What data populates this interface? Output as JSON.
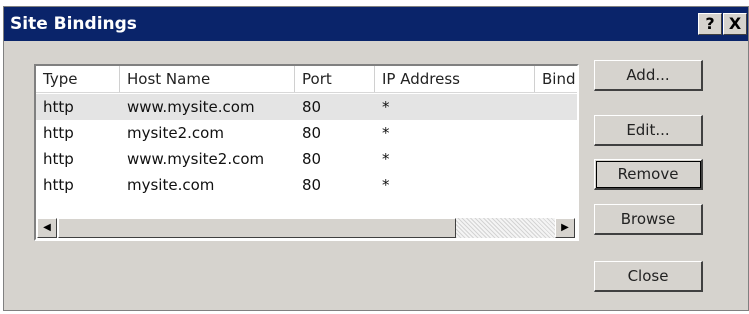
{
  "window": {
    "title": "Site Bindings",
    "help_label": "?",
    "close_label": "X"
  },
  "table": {
    "columns": [
      "Type",
      "Host Name",
      "Port",
      "IP Address",
      "Bind"
    ],
    "rows": [
      {
        "type": "http",
        "host": "www.mysite.com",
        "port": "80",
        "ip": "*",
        "selected": true
      },
      {
        "type": "http",
        "host": "mysite2.com",
        "port": "80",
        "ip": "*",
        "selected": false
      },
      {
        "type": "http",
        "host": "www.mysite2.com",
        "port": "80",
        "ip": "*",
        "selected": false
      },
      {
        "type": "http",
        "host": "mysite.com",
        "port": "80",
        "ip": "*",
        "selected": false
      }
    ]
  },
  "scrollbar": {
    "left_arrow": "◀",
    "right_arrow": "▶"
  },
  "buttons": {
    "add": "Add...",
    "edit": "Edit...",
    "remove": "Remove",
    "browse": "Browse",
    "close": "Close"
  },
  "colors": {
    "titlebar": "#0a246a",
    "dialog_face": "#d6d3ce",
    "selected_row": "#e4e4e4"
  }
}
